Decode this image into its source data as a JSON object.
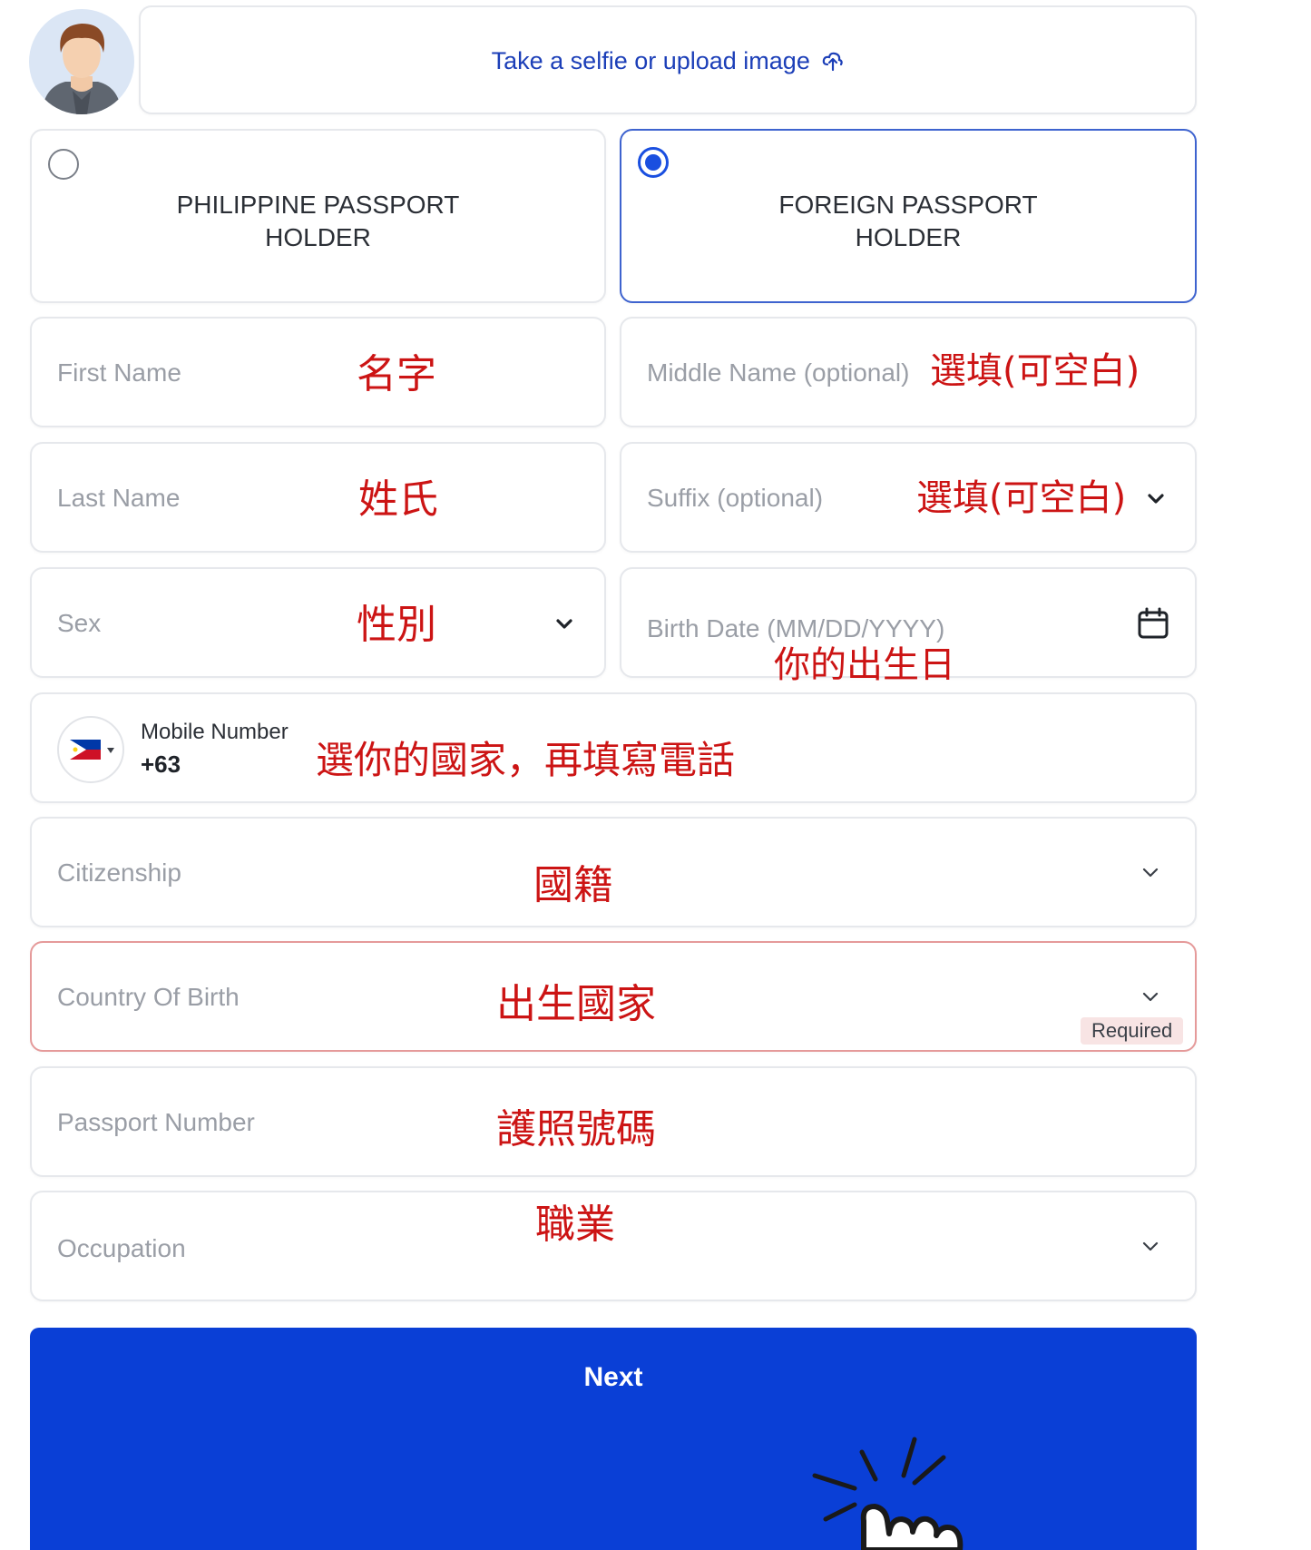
{
  "upload": {
    "label": "Take a selfie or upload image"
  },
  "passport_type": {
    "philippine": {
      "line1": "PHILIPPINE PASSPORT",
      "line2": "HOLDER",
      "selected": false
    },
    "foreign": {
      "line1": "FOREIGN PASSPORT",
      "line2": "HOLDER",
      "selected": true
    }
  },
  "fields": {
    "first_name": {
      "placeholder": "First Name",
      "annotation": "名字"
    },
    "middle_name": {
      "placeholder": "Middle Name (optional)",
      "annotation": "選填(可空白)"
    },
    "last_name": {
      "placeholder": "Last Name",
      "annotation": "姓氏"
    },
    "suffix": {
      "placeholder": "Suffix (optional)",
      "annotation": "選填(可空白)"
    },
    "sex": {
      "placeholder": "Sex",
      "annotation": "性別"
    },
    "birth_date": {
      "placeholder": "Birth Date (MM/DD/YYYY)",
      "annotation": "你的出生日"
    },
    "mobile": {
      "label": "Mobile Number",
      "code": "+63",
      "annotation": "選你的國家，再填寫電話"
    },
    "citizenship": {
      "placeholder": "Citizenship",
      "annotation": "國籍"
    },
    "country_of_birth": {
      "placeholder": "Country Of Birth",
      "annotation": "出生國家",
      "error": "Required"
    },
    "passport_number": {
      "placeholder": "Passport Number",
      "annotation": "護照號碼"
    },
    "occupation": {
      "placeholder": "Occupation",
      "annotation": "職業"
    }
  },
  "next_button": {
    "label": "Next"
  },
  "colors": {
    "primary": "#0a3fd6",
    "link": "#1c3fb8",
    "error": "#e07a7a",
    "annotation": "#cc1414",
    "border": "#e6e8ec"
  }
}
